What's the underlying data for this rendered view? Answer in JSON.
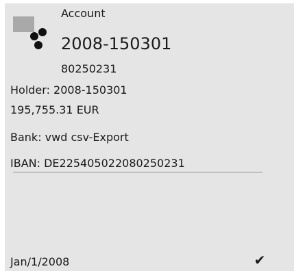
{
  "account_card": {
    "kind_label": "Account",
    "name": "2008-150301",
    "number": "80250231",
    "holder": "Holder: 2008-150301",
    "balance": "195,755.31 EUR",
    "bank": "Bank: vwd csv-Export",
    "iban": "IBAN: DE22540502208025023​1",
    "date": "Jan/1/2008",
    "status_icon": "checkmark-icon"
  }
}
